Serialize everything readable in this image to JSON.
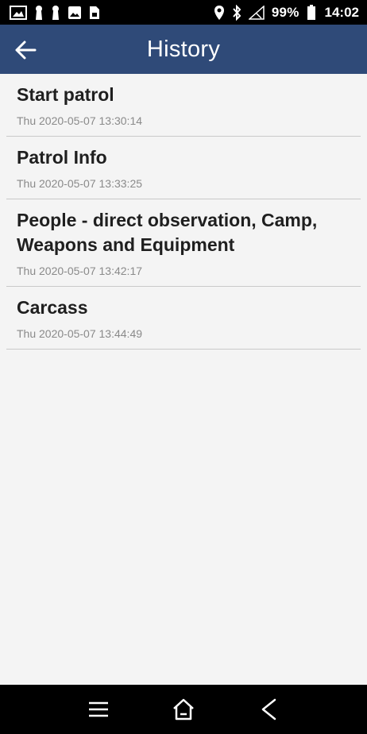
{
  "status_bar": {
    "battery_percent": "99%",
    "time": "14:02",
    "left_icons": [
      "gallery-icon",
      "keyhole-icon",
      "keyhole-icon",
      "image-icon",
      "sim-card-icon"
    ],
    "right_icons": [
      "location-pin-icon",
      "bluetooth-icon",
      "signal-icon",
      "battery-icon"
    ]
  },
  "app_bar": {
    "title": "History",
    "back_icon": "arrow-left-icon",
    "background_color": "#2f4a78"
  },
  "history": {
    "items": [
      {
        "title": "Start patrol",
        "timestamp": "Thu 2020-05-07 13:30:14"
      },
      {
        "title": "Patrol Info",
        "timestamp": "Thu 2020-05-07 13:33:25"
      },
      {
        "title": "People - direct observation, Camp, Weapons and Equipment",
        "timestamp": "Thu 2020-05-07 13:42:17"
      },
      {
        "title": "Carcass",
        "timestamp": "Thu 2020-05-07 13:44:49"
      }
    ]
  },
  "nav_bar": {
    "icons": [
      "menu-icon",
      "home-icon",
      "back-chevron-icon"
    ]
  }
}
